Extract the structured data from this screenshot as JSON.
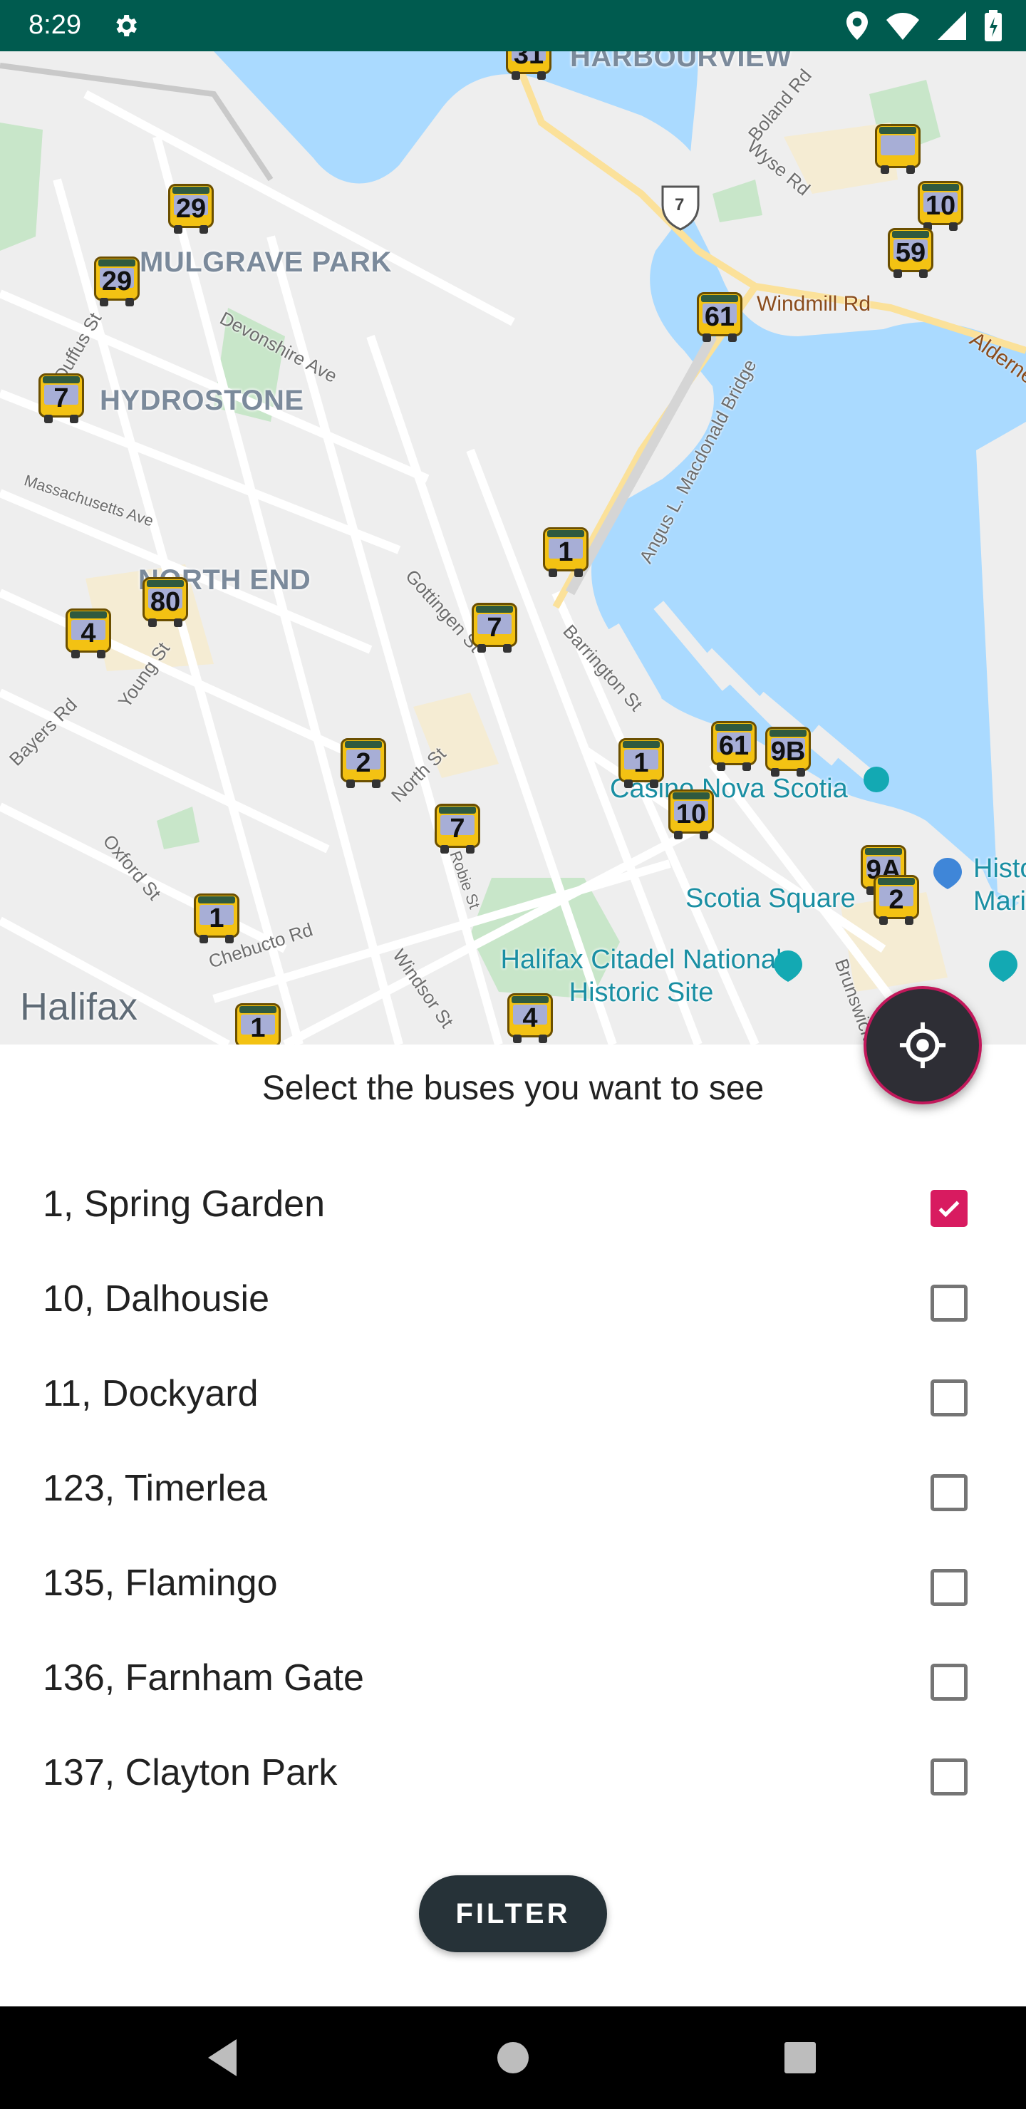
{
  "status_bar": {
    "time": "8:29",
    "icons": [
      "gear-icon",
      "location-icon",
      "wifi-icon",
      "signal-icon",
      "battery-icon"
    ]
  },
  "map": {
    "area_labels": [
      "HARBOURVIEW",
      "MULGRAVE PARK",
      "HYDROSTONE",
      "NORTH END"
    ],
    "street_labels": [
      "Boland Rd",
      "Wyse Rd",
      "Devonshire Ave",
      "Duffus St",
      "Massachusetts Ave",
      "Gottingen St",
      "Barrington St",
      "Angus L. Macdonald Bridge",
      "Young St",
      "Bayers Rd",
      "North St",
      "Robie St",
      "Oxford St",
      "Chebucto Rd",
      "Windsor St",
      "Brunswick St",
      "Alderney Dr"
    ],
    "road_labels": [
      "Windmill Rd",
      "7"
    ],
    "poi_labels": [
      "Casino Nova Scotia",
      "Scotia Square",
      "Halifax Citadel National Historic Site",
      "Historic Maritime"
    ],
    "city_label": "Halifax",
    "bus_markers": [
      "31",
      "29",
      "29",
      "7",
      "61",
      "10",
      "59",
      "1",
      "80",
      "4",
      "7",
      "2",
      "1",
      "61",
      "9B",
      "10",
      "7",
      "1",
      "9A",
      "2",
      "1",
      "4"
    ]
  },
  "sheet": {
    "title": "Select the buses you want to see",
    "routes": [
      {
        "label": "1, Spring Garden",
        "checked": true
      },
      {
        "label": "10, Dalhousie",
        "checked": false
      },
      {
        "label": "11, Dockyard",
        "checked": false
      },
      {
        "label": "123, Timerlea",
        "checked": false
      },
      {
        "label": "135, Flamingo",
        "checked": false
      },
      {
        "label": "136, Farnham Gate",
        "checked": false
      },
      {
        "label": "137, Clayton Park",
        "checked": false
      }
    ],
    "filter_label": "FILTER"
  },
  "colors": {
    "status_bar": "#005b4f",
    "water": "#aadaff",
    "checkbox_accent": "#d81b60",
    "button_dark": "#263238",
    "bus_yellow": "#f3c213"
  }
}
